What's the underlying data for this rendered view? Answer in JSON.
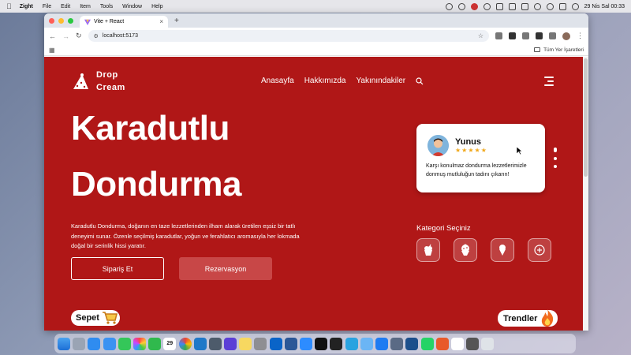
{
  "menubar": {
    "app_name": "Zight",
    "items": [
      "File",
      "Edit",
      "Item",
      "Tools",
      "Window",
      "Help"
    ],
    "clock": "29 Nis Sal  00:33"
  },
  "browser": {
    "tab_title": "Vite + React",
    "url": "localhost:5173",
    "bookmarks_all": "Tüm Yer İşaretleri"
  },
  "site": {
    "logo_line1": "Drop",
    "logo_line2": "Cream",
    "nav": [
      "Anasayfa",
      "Hakkımızda",
      "Yakınındakiler"
    ],
    "hero_title_line1": "Karadutlu",
    "hero_title_line2": "Dondurma",
    "hero_desc": "Karadutlu Dondurma, doğanın en taze lezzetlerinden ilham alarak üretilen eşsiz bir tatlı deneyimi sunar. Özenle seçilmiş karadutlar, yoğun ve ferahlatıcı aromasıyla her lokmada doğal bir serinlik hissi yaratır.",
    "order_button": "Sipariş Et",
    "reservation_button": "Rezervasyon",
    "review": {
      "name": "Yunus",
      "stars": "★★★★★",
      "rating": 5,
      "text": "Karşı konulmaz dondurma lezzetlerimizle donmuş mutluluğun tadını çıkarın!"
    },
    "category_title": "Kategori Seçiniz",
    "categories": [
      "icecream-cup-icon",
      "sundae-icon",
      "cone-icon",
      "add-icon"
    ],
    "cart_label": "Sepet",
    "trends_label": "Trendler"
  },
  "colors": {
    "primary": "#b01717",
    "button_filled": "#c84747",
    "star": "#f0a81c"
  },
  "dock": {
    "apps": [
      "finder-icon",
      "launchpad-icon",
      "safari-icon",
      "mail-icon",
      "messages-icon",
      "photos-icon",
      "facetime-icon",
      "calendar-icon",
      "chrome-icon",
      "vscode-icon",
      "quicktime-icon",
      "imovie-icon",
      "notes-icon",
      "settings-icon",
      "outlook-icon",
      "word-icon",
      "zoom-icon",
      "github-icon",
      "terminal-icon",
      "telegram-icon",
      "preview-icon",
      "xcode-icon",
      "simulator-icon",
      "sourcetree-icon",
      "whatsapp-icon",
      "pen-icon",
      "slack-icon",
      "calculator-icon",
      "trash-icon"
    ],
    "calendar_day": "29"
  }
}
